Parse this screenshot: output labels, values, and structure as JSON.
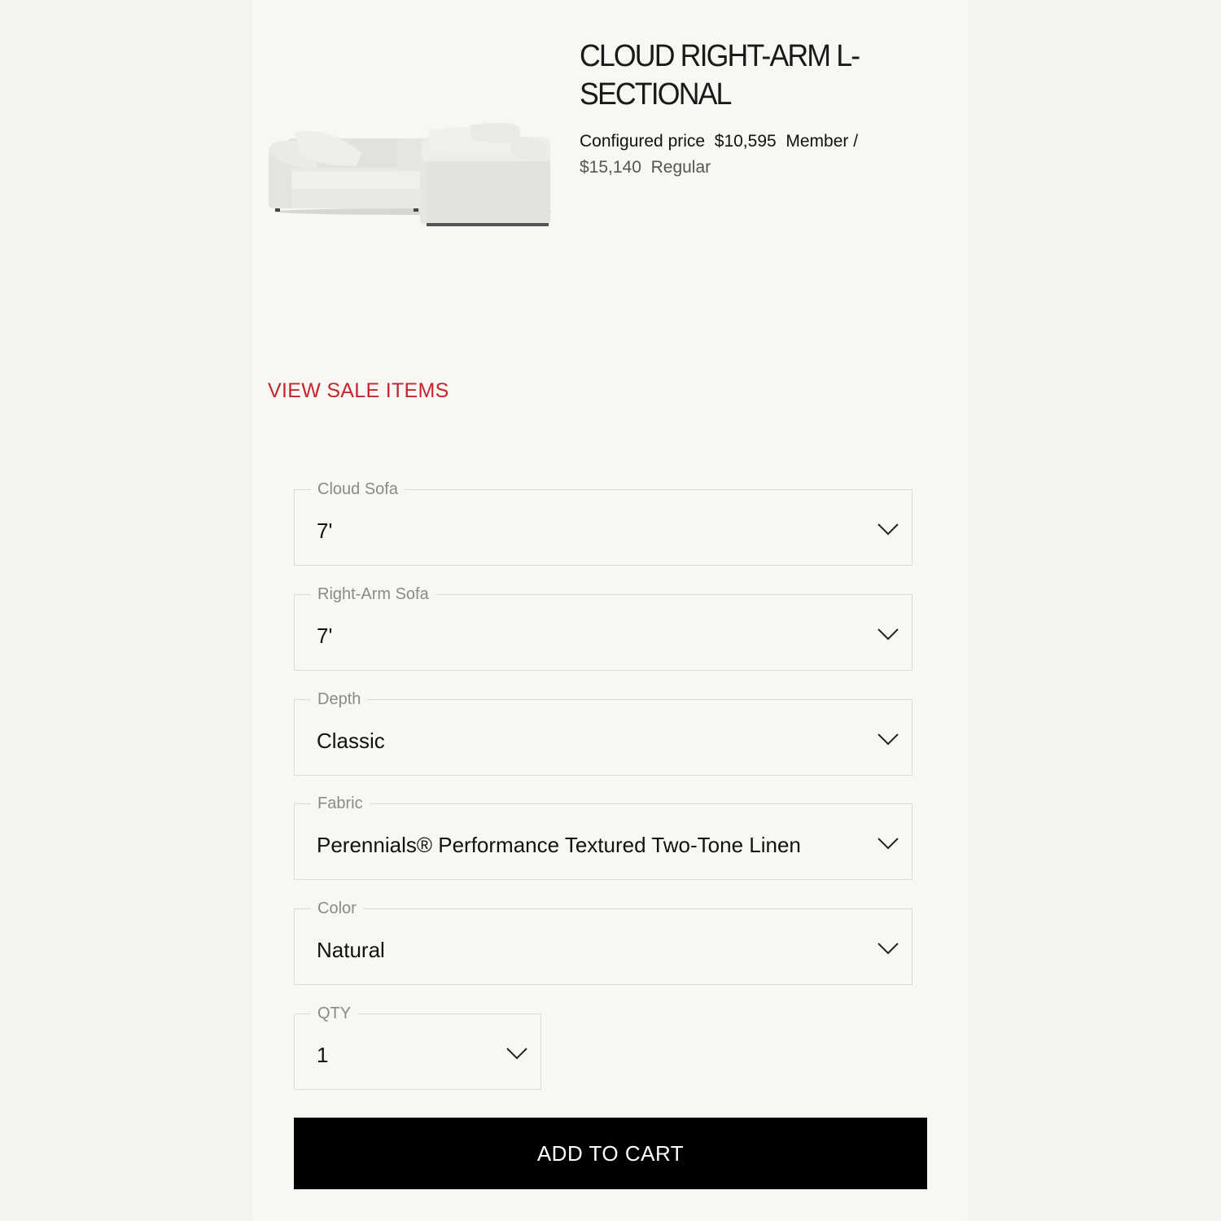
{
  "product": {
    "title": "CLOUD RIGHT-ARM L-SECTIONAL",
    "configured_price_label": "Configured price",
    "member_price": "$10,595",
    "member_label": "Member /",
    "regular_price": "$15,140",
    "regular_label": "Regular"
  },
  "sale_link": "VIEW SALE ITEMS",
  "options": [
    {
      "label": "Cloud Sofa",
      "value": "7'"
    },
    {
      "label": "Right-Arm Sofa",
      "value": "7'"
    },
    {
      "label": "Depth",
      "value": "Classic"
    },
    {
      "label": "Fabric",
      "value": "Perennials® Performance Textured Two-Tone Linen"
    },
    {
      "label": "Color",
      "value": "Natural"
    }
  ],
  "qty": {
    "label": "QTY",
    "value": "1"
  },
  "add_to_cart": "ADD TO CART",
  "colors": {
    "accent_red": "#c3262e",
    "button_bg": "#000000",
    "page_bg": "#f8f7f4"
  },
  "icons": [
    "chevron-down-icon"
  ]
}
